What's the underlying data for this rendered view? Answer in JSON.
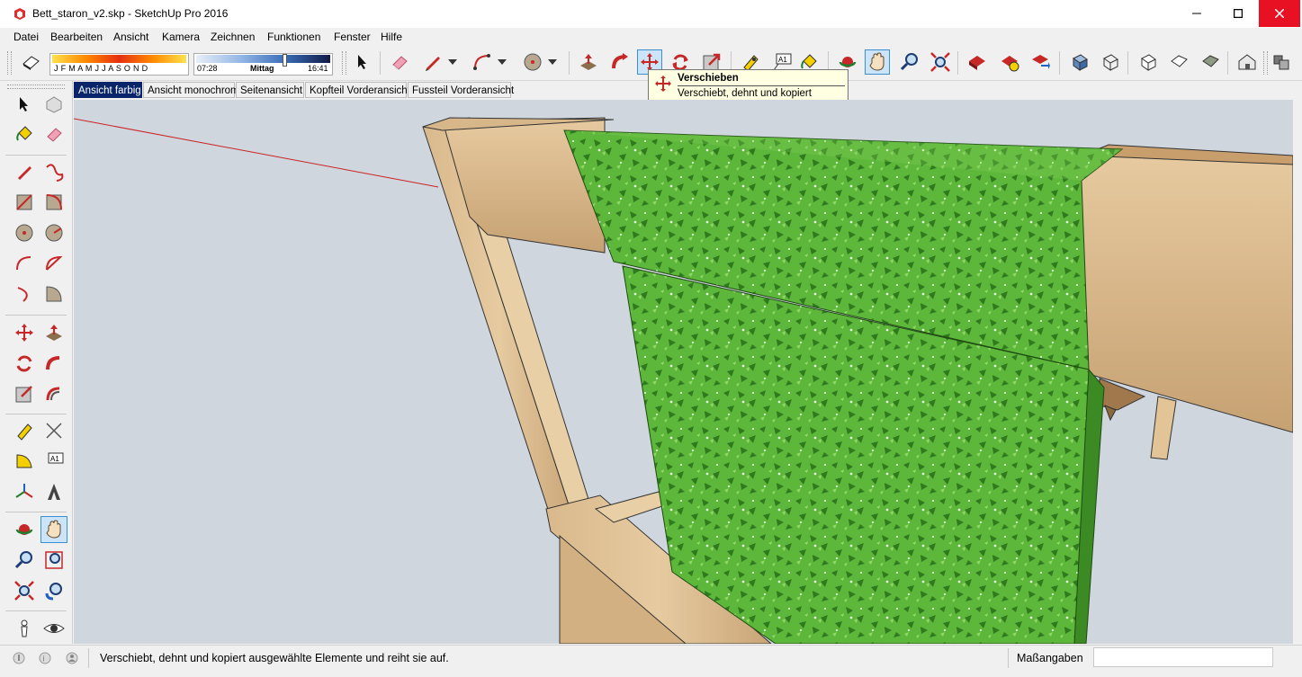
{
  "window": {
    "title": "Bett_staron_v2.skp - SketchUp Pro 2016",
    "min_icon": "minimize-icon",
    "max_icon": "maximize-icon",
    "close_icon": "close-icon"
  },
  "menu": [
    "Datei",
    "Bearbeiten",
    "Ansicht",
    "Kamera",
    "Zeichnen",
    "Funktionen",
    "Fenster",
    "Hilfe"
  ],
  "shadow": {
    "months": "J F M A M J J A S O N D",
    "time_start": "07:28",
    "time_mid": "Mittag",
    "time_end": "16:41"
  },
  "tabs": [
    "Ansicht farbig",
    "Ansicht monochrom",
    "Seitenansicht",
    "Kopfteil Vorderansicht",
    "Fussteil Vorderansicht"
  ],
  "active_tab": "Ansicht farbig",
  "tooltip": {
    "title": "Verschieben",
    "description": "Verschiebt, dehnt und kopiert ausgewählte Elemente und reiht sie auf."
  },
  "tooltip_label": "A1",
  "status": {
    "message": "Verschiebt, dehnt und kopiert ausgewählte Elemente und reiht sie auf.",
    "measurements_label": "Maßangaben",
    "measurements_value": ""
  },
  "colors": {
    "accent": "#0a246a",
    "close_red": "#e81123",
    "texture_green": "#5cb73a",
    "wood": "#d9b98c"
  }
}
